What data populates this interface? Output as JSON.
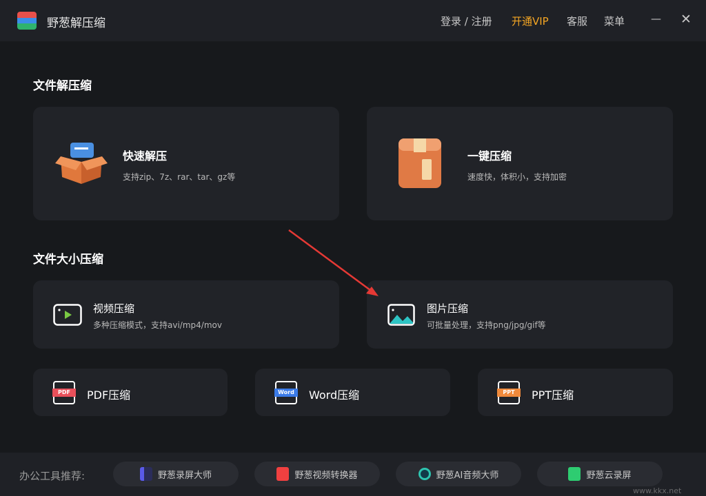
{
  "header": {
    "title": "野葱解压缩",
    "login": "登录 / 注册",
    "vip": "开通VIP",
    "service": "客服",
    "menu": "菜单",
    "minimize": "—",
    "close": "✕"
  },
  "sections": {
    "extract": "文件解压缩",
    "size": "文件大小压缩"
  },
  "cards": {
    "quick_extract": {
      "title": "快速解压",
      "sub": "支持zip、7z、rar、tar、gz等"
    },
    "one_click": {
      "title": "一键压缩",
      "sub": "速度快，体积小，支持加密"
    },
    "video": {
      "title": "视频压缩",
      "sub": "多种压缩模式，支持avi/mp4/mov"
    },
    "image": {
      "title": "图片压缩",
      "sub": "可批量处理，支持png/jpg/gif等"
    },
    "pdf": {
      "title": "PDF压缩",
      "badge": "PDF"
    },
    "word": {
      "title": "Word压缩",
      "badge": "Word"
    },
    "ppt": {
      "title": "PPT压缩",
      "badge": "PPT"
    }
  },
  "footer": {
    "label": "办公工具推荐:",
    "tools": [
      "野葱录屏大师",
      "野葱视频转换器",
      "野葱AI音频大师",
      "野葱云录屏"
    ]
  },
  "watermark": "www.kkx.net",
  "colors": {
    "vip": "#f5a623",
    "pdf": "#e8505b",
    "word": "#3b7be8",
    "ppt": "#f08a3c",
    "arrow": "#e53935"
  }
}
